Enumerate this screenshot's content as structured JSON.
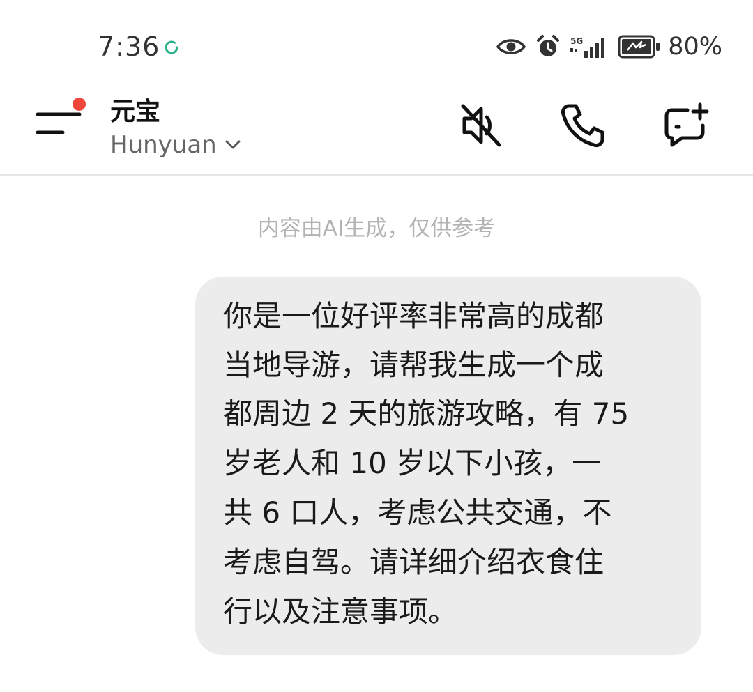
{
  "status_bar": {
    "time": "7:36",
    "sync_icon": "sync-icon",
    "icons": [
      "eye-icon",
      "alarm-icon",
      "signal-5g-icon",
      "battery-saver-icon"
    ],
    "network_label": "5G",
    "battery_percent": "80%",
    "accent_color": "#2bb28a"
  },
  "header": {
    "bot_name": "元宝",
    "model_name": "Hunyuan",
    "has_notification": true,
    "notification_color": "#f0453a",
    "actions": [
      "mute-icon",
      "phone-icon",
      "new-chat-icon"
    ]
  },
  "chat": {
    "disclaimer": "内容由AI生成，仅供参考",
    "messages": [
      {
        "role": "user",
        "lines": [
          "你是一位好评率非常高的成都",
          "当地导游，请帮我生成一个成",
          "都周边 2 天的旅游攻略，有 75",
          "岁老人和 10 岁以下小孩，一",
          "共 6 口人，考虑公共交通，不",
          "考虑自驾。请详细介绍衣食住",
          "行以及注意事项。"
        ]
      }
    ]
  }
}
